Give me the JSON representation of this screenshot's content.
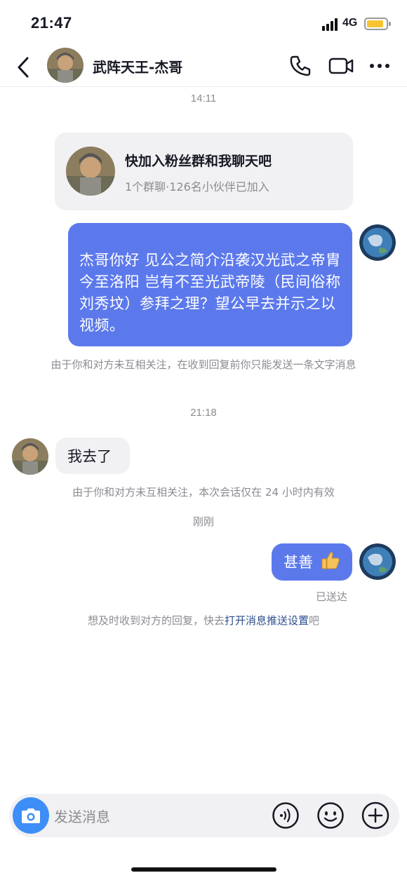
{
  "status_bar": {
    "time": "21:47",
    "network": "4G",
    "battery_color": "#f7c531"
  },
  "header": {
    "contact_name": "武阵天王-杰哥",
    "icons": [
      "back-icon",
      "phone-icon",
      "video-icon",
      "more-icon"
    ]
  },
  "messages": {
    "time_1": "14:11",
    "group_card": {
      "title": "快加入粉丝群和我聊天吧",
      "subtitle": "1个群聊·126名小伙伴已加入"
    },
    "outgoing_1": "杰哥你好 见公之简介沿袭汉光武之帝胄 今至洛阳 岂有不至光武帝陵（民间俗称刘秀坟）参拜之理？望公早去并示之以视频。",
    "notice_1": "由于你和对方未互相关注，在收到回复前你只能发送一条文字消息",
    "time_2": "21:18",
    "incoming_1": "我去了",
    "notice_2": "由于你和对方未互相关注，本次会话仅在 24 小时内有效",
    "time_3": "刚刚",
    "outgoing_2": "甚善",
    "delivered": "已送达",
    "push_tip_prefix": "想及时收到对方的回复，快去",
    "push_tip_link": "打开消息推送设置",
    "push_tip_suffix": "吧"
  },
  "input_bar": {
    "placeholder": "发送消息",
    "icons": [
      "camera-icon",
      "voice-icon",
      "emoji-icon",
      "plus-icon"
    ]
  },
  "colors": {
    "outgoing_bubble": "#5c79ec",
    "incoming_bubble": "#f1f1f3",
    "camera_button": "#3e8ef7",
    "link": "#2d4e8d"
  }
}
